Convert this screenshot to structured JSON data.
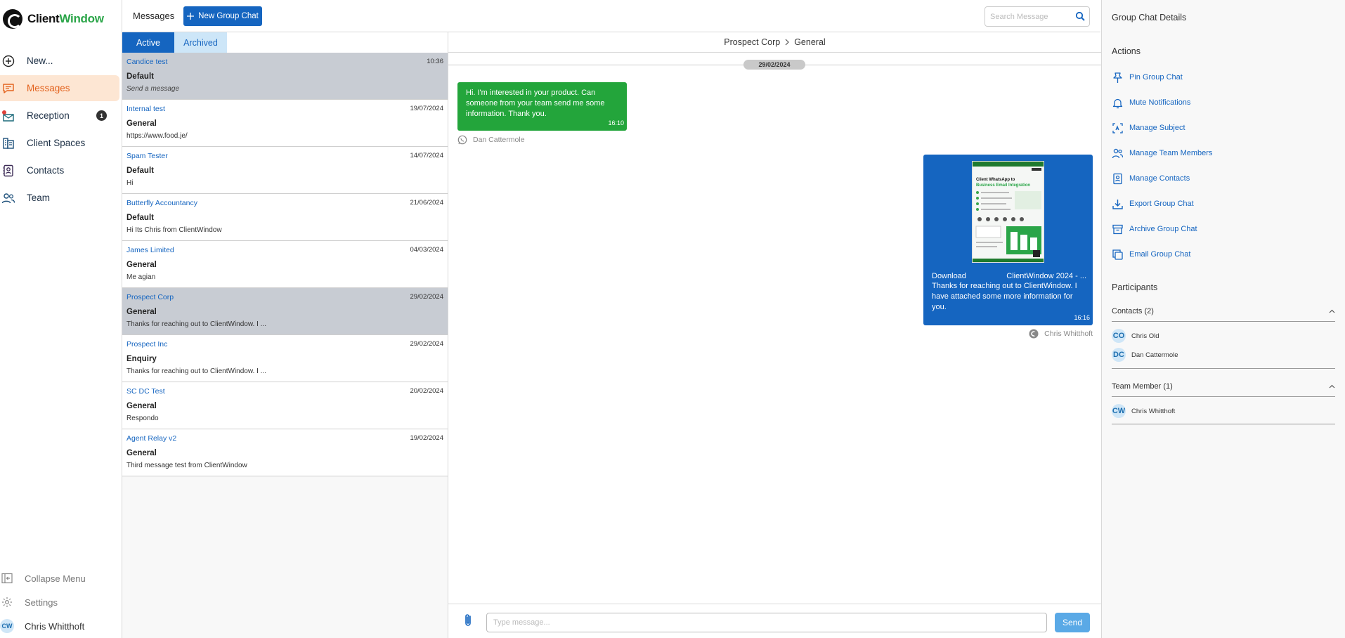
{
  "app": {
    "brand_part1": "Client",
    "brand_part2": "Window",
    "brand_color": "#2aa548",
    "accent": "#1565c0",
    "active_nav_color": "#e3621d"
  },
  "nav": {
    "items": [
      {
        "label": "New...",
        "icon": "plus-circle-icon"
      },
      {
        "label": "Messages",
        "icon": "chat-icon",
        "active": true
      },
      {
        "label": "Reception",
        "icon": "inbox-icon",
        "badge": "1"
      },
      {
        "label": "Client Spaces",
        "icon": "building-icon"
      },
      {
        "label": "Contacts",
        "icon": "contacts-book-icon"
      },
      {
        "label": "Team",
        "icon": "team-icon"
      }
    ],
    "collapse_label": "Collapse Menu",
    "settings_label": "Settings",
    "user_initials": "CW",
    "user_name": "Chris Whitthoft"
  },
  "header": {
    "title": "Messages",
    "new_group_label": "New Group Chat",
    "search_placeholder": "Search Message"
  },
  "tabs": {
    "active": "Active",
    "archived": "Archived"
  },
  "conversations": [
    {
      "name": "Candice test",
      "date": "10:36",
      "subject": "Default",
      "preview": "Send a message",
      "italic": true,
      "selected": true
    },
    {
      "name": "Internal test",
      "date": "19/07/2024",
      "subject": "General",
      "preview": "https://www.food.je/"
    },
    {
      "name": "Spam Tester",
      "date": "14/07/2024",
      "subject": "Default",
      "preview": "Hi"
    },
    {
      "name": "Butterfly Accountancy",
      "date": "21/06/2024",
      "subject": "Default",
      "preview": "Hi Its Chris from ClientWindow"
    },
    {
      "name": "James Limited",
      "date": "04/03/2024",
      "subject": "General",
      "preview": "Me agian"
    },
    {
      "name": "Prospect Corp",
      "date": "29/02/2024",
      "subject": "General",
      "preview": "Thanks for reaching out to ClientWindow. I ...",
      "selected": true
    },
    {
      "name": "Prospect Inc",
      "date": "29/02/2024",
      "subject": "Enquiry",
      "preview": "Thanks for reaching out to ClientWindow. I ..."
    },
    {
      "name": "SC DC Test",
      "date": "20/02/2024",
      "subject": "General",
      "preview": "Respondo"
    },
    {
      "name": "Agent Relay v2",
      "date": "19/02/2024",
      "subject": "General",
      "preview": "Third message test from ClientWindow"
    }
  ],
  "chat": {
    "breadcrumb_org": "Prospect Corp",
    "breadcrumb_group": "General",
    "date_divider": "29/02/2024",
    "incoming": {
      "text": "Hi. I'm interested in your product. Can someone from your team send me some information. Thank you.",
      "time": "16:10",
      "sender": "Dan Cattermole",
      "channel_icon": "whatsapp-icon"
    },
    "outgoing": {
      "attachment_label": "Download",
      "attachment_name": "ClientWindow 2024 - ...",
      "attachment_title_1": "Client WhatsApp to",
      "attachment_title_2": "Business Email Integration",
      "text": "Thanks for reaching out to ClientWindow. I have attached some more information for you.",
      "time": "16:16",
      "sender": "Chris Whitthoft",
      "channel_icon": "clientwindow-icon"
    },
    "composer_placeholder": "Type message...",
    "send_label": "Send"
  },
  "details": {
    "title": "Group Chat Details",
    "actions_heading": "Actions",
    "actions": [
      {
        "label": "Pin Group Chat",
        "icon": "pin-icon"
      },
      {
        "label": "Mute Notifications",
        "icon": "bell-icon"
      },
      {
        "label": "Manage Subject",
        "icon": "subject-icon"
      },
      {
        "label": "Manage Team Members",
        "icon": "team-members-icon"
      },
      {
        "label": "Manage Contacts",
        "icon": "contacts-icon"
      },
      {
        "label": "Export Group Chat",
        "icon": "download-icon"
      },
      {
        "label": "Archive Group Chat",
        "icon": "archive-icon"
      },
      {
        "label": "Email Group Chat",
        "icon": "copy-icon"
      }
    ],
    "participants_heading": "Participants",
    "contacts_group": "Contacts (2)",
    "contacts": [
      {
        "initials": "CO",
        "name": "Chris Old"
      },
      {
        "initials": "DC",
        "name": "Dan Cattermole"
      }
    ],
    "team_group": "Team Member (1)",
    "team": [
      {
        "initials": "CW",
        "name": "Chris Whitthoft"
      }
    ]
  }
}
